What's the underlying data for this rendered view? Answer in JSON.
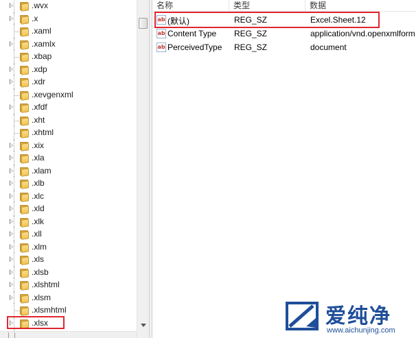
{
  "tree": {
    "items": [
      {
        "label": ".wvx",
        "expandable": true
      },
      {
        "label": ".x",
        "expandable": true
      },
      {
        "label": ".xaml",
        "expandable": false
      },
      {
        "label": ".xamlx",
        "expandable": true
      },
      {
        "label": ".xbap",
        "expandable": false
      },
      {
        "label": ".xdp",
        "expandable": true
      },
      {
        "label": ".xdr",
        "expandable": true
      },
      {
        "label": ".xevgenxml",
        "expandable": false
      },
      {
        "label": ".xfdf",
        "expandable": true
      },
      {
        "label": ".xht",
        "expandable": false
      },
      {
        "label": ".xhtml",
        "expandable": false
      },
      {
        "label": ".xix",
        "expandable": true
      },
      {
        "label": ".xla",
        "expandable": true
      },
      {
        "label": ".xlam",
        "expandable": true
      },
      {
        "label": ".xlb",
        "expandable": true
      },
      {
        "label": ".xlc",
        "expandable": true
      },
      {
        "label": ".xld",
        "expandable": true
      },
      {
        "label": ".xlk",
        "expandable": true
      },
      {
        "label": ".xll",
        "expandable": true
      },
      {
        "label": ".xlm",
        "expandable": true
      },
      {
        "label": ".xls",
        "expandable": true
      },
      {
        "label": ".xlsb",
        "expandable": true
      },
      {
        "label": ".xlshtml",
        "expandable": true
      },
      {
        "label": ".xlsm",
        "expandable": true
      },
      {
        "label": ".xlsmhtml",
        "expandable": false
      },
      {
        "label": ".xlsx",
        "expandable": true,
        "highlighted": true
      }
    ]
  },
  "columns": {
    "name": "名称",
    "type": "类型",
    "data": "数据"
  },
  "values": [
    {
      "icon": "ab",
      "name": "(默认)",
      "type": "REG_SZ",
      "data": "Excel.Sheet.12",
      "highlighted": true
    },
    {
      "icon": "ab",
      "name": "Content Type",
      "type": "REG_SZ",
      "data": "application/vnd.openxmlform"
    },
    {
      "icon": "ab",
      "name": "PerceivedType",
      "type": "REG_SZ",
      "data": "document"
    }
  ],
  "watermark": {
    "brand_cn": "爱纯净",
    "url": "www.aichunjing.com"
  },
  "colors": {
    "highlight": "#e0262e",
    "folder": "#f2c453",
    "watermark": "#1f4e9a"
  }
}
